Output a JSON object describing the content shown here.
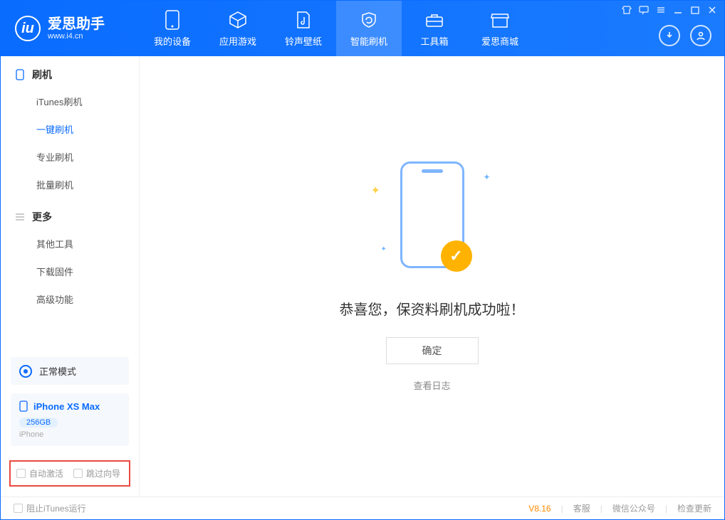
{
  "app": {
    "title": "爱思助手",
    "subtitle": "www.i4.cn"
  },
  "nav": {
    "tabs": [
      {
        "label": "我的设备"
      },
      {
        "label": "应用游戏"
      },
      {
        "label": "铃声壁纸"
      },
      {
        "label": "智能刷机"
      },
      {
        "label": "工具箱"
      },
      {
        "label": "爱思商城"
      }
    ]
  },
  "sidebar": {
    "group1_title": "刷机",
    "group1_items": [
      "iTunes刷机",
      "一键刷机",
      "专业刷机",
      "批量刷机"
    ],
    "group2_title": "更多",
    "group2_items": [
      "其他工具",
      "下载固件",
      "高级功能"
    ],
    "mode_label": "正常模式",
    "device_name": "iPhone XS Max",
    "device_capacity": "256GB",
    "device_type": "iPhone",
    "check1": "自动激活",
    "check2": "跳过向导"
  },
  "main": {
    "success_text": "恭喜您，保资料刷机成功啦！",
    "confirm_label": "确定",
    "view_log_label": "查看日志"
  },
  "footer": {
    "block_itunes": "阻止iTunes运行",
    "version": "V8.16",
    "links": [
      "客服",
      "微信公众号",
      "检查更新"
    ]
  }
}
